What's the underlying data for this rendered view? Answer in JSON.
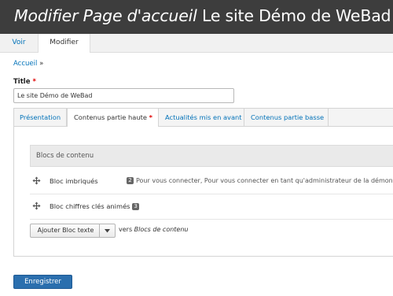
{
  "header": {
    "title_prefix": "Modifier Page d'accueil",
    "title_site": "Le site Démo de WeBad"
  },
  "primary_tabs": [
    {
      "label": "Voir",
      "active": false
    },
    {
      "label": "Modifier",
      "active": true
    }
  ],
  "breadcrumb": {
    "home_label": "Accueil",
    "separator": "»"
  },
  "title_field": {
    "label": "Title",
    "required_mark": "*",
    "value": "Le site Démo de WeBad"
  },
  "vertical_tabs": [
    {
      "label": "Présentation",
      "active": false
    },
    {
      "label": "Contenus partie haute",
      "active": true,
      "required_mark": "*"
    },
    {
      "label": "Actualités mis en avant",
      "active": false
    },
    {
      "label": "Contenus partie basse",
      "active": false
    }
  ],
  "blocks_table": {
    "header": "Blocs de contenu",
    "rows": [
      {
        "label": "Bloc imbriqués",
        "summary_count": "2",
        "summary": "Pour vous connecter, Pour vous connecter en tant qu'administrateur de la démonstrat"
      },
      {
        "label": "Bloc chiffres clés animés",
        "count": "3"
      }
    ]
  },
  "add_control": {
    "button_label": "Ajouter Bloc texte",
    "to_prefix": "vers",
    "to_target": "Blocs de contenu"
  },
  "actions": {
    "save_label": "Enregistrer"
  },
  "colors": {
    "header_bg": "#3d3d3d",
    "link": "#0071b8",
    "primary_button": "#2b6fae",
    "required": "#e00000"
  }
}
